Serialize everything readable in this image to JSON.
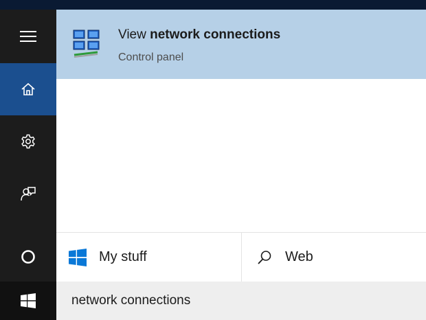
{
  "result": {
    "title_prefix": "View ",
    "title_bold": "network connections",
    "subtitle": "Control panel",
    "icon": "network-connections-icon"
  },
  "rail": {
    "icons": [
      "hamburger-menu-icon",
      "home-icon",
      "settings-gear-icon",
      "feedback-icon",
      "cortana-circle-icon",
      "windows-start-icon"
    ],
    "active": "home",
    "active_color": "#1b4f8f"
  },
  "scopes": {
    "my_stuff": {
      "label": "My stuff",
      "icon": "windows-logo-icon"
    },
    "web": {
      "label": "Web",
      "icon": "search-icon"
    }
  },
  "search": {
    "query": "network connections"
  },
  "colors": {
    "result_highlight": "#b6d0e7",
    "windows_blue": "#0a78d7",
    "rail_background": "#1c1c1c"
  }
}
